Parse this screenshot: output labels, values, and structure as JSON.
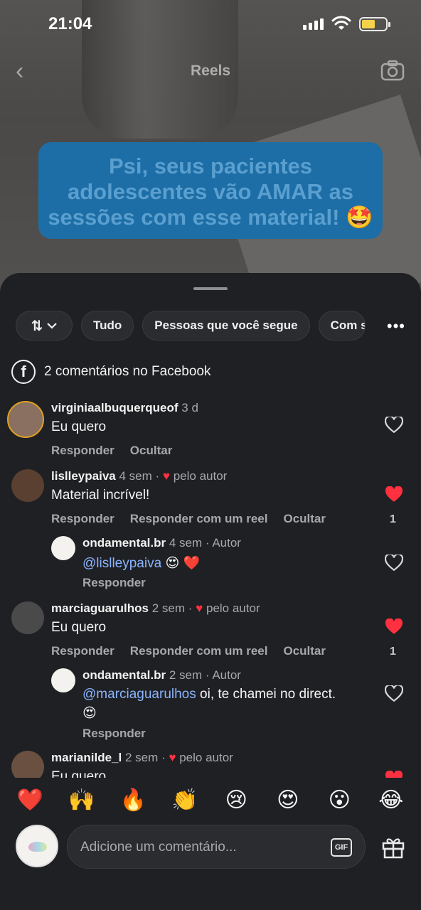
{
  "status_bar": {
    "time": "21:04"
  },
  "header": {
    "title": "Reels"
  },
  "video": {
    "caption": "Psi, seus pacientes adolescentes vão AMAR as sessões com esse material! 🤩"
  },
  "filters": {
    "sort_label": "⇅",
    "chips": [
      "Tudo",
      "Pessoas que você segue",
      "Com s"
    ],
    "more_label": "•••"
  },
  "facebook": {
    "label": "2 comentários no Facebook"
  },
  "comments": [
    {
      "user": "virginiaalbuquerqueof",
      "time": "3 d",
      "text": "Eu quero",
      "actions": [
        "Responder",
        "Ocultar"
      ],
      "liked": false
    },
    {
      "user": "lislleypaiva",
      "time": "4 sem ·",
      "liked_by_author": "pelo autor",
      "text": "Material incrível!",
      "actions": [
        "Responder",
        "Responder com um reel",
        "Ocultar"
      ],
      "liked": true,
      "like_count": "1"
    },
    {
      "user": "ondamental.br",
      "time": "4 sem · Autor",
      "mention": "@lislleypaiva",
      "text": " 😍 ❤️",
      "actions": [
        "Responder"
      ],
      "liked": false
    },
    {
      "user": "marciaguarulhos",
      "time": "2 sem ·",
      "liked_by_author": "pelo autor",
      "text": "Eu quero",
      "actions": [
        "Responder",
        "Responder com um reel",
        "Ocultar"
      ],
      "liked": true,
      "like_count": "1"
    },
    {
      "user": "ondamental.br",
      "time": "2 sem · Autor",
      "mention": "@marciaguarulhos",
      "text": " oi, te chamei no direct.",
      "text2": "😍",
      "actions": [
        "Responder"
      ],
      "liked": false
    },
    {
      "user": "marianilde_l",
      "time": "2 sem ·",
      "liked_by_author": "pelo autor",
      "text": "Eu quero",
      "liked": true
    }
  ],
  "emoji_bar": [
    "❤️",
    "🙌",
    "🔥",
    "👏",
    "😢",
    "😍",
    "😮",
    "😂"
  ],
  "composer": {
    "placeholder": "Adicione um comentário...",
    "gif_label": "GIF"
  },
  "colors": {
    "like_red": "#ff3040",
    "mention_blue": "#8ab4ff",
    "sheet_bg": "#1f2023"
  }
}
